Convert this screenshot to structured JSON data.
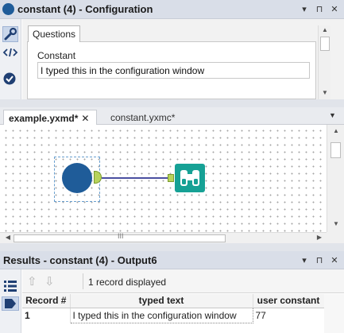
{
  "config": {
    "title": "constant (4) - Configuration",
    "tab_questions": "Questions",
    "constant_label": "Constant",
    "constant_value": "I typed this in the configuration window",
    "header_controls": [
      "▾",
      "⊓",
      "✕"
    ]
  },
  "document_tabs": [
    {
      "label": "example.yxmd*",
      "active": true,
      "close": "✕"
    },
    {
      "label": "constant.yxmc*",
      "active": false
    }
  ],
  "tabs_dropdown": "▼",
  "canvas": {
    "nodes": [
      {
        "name": "constant-tool",
        "color": "#1f5c99"
      },
      {
        "name": "browse-tool",
        "color": "#16a195"
      }
    ],
    "hscroll_grip": "III"
  },
  "results": {
    "title": "Results - constant (4) - Output6",
    "header_controls": [
      "▾",
      "⊓",
      "✕"
    ],
    "record_count": "1 record displayed",
    "columns": [
      "Record #",
      "typed text",
      "user constant"
    ],
    "rows": [
      [
        "1",
        "I typed this in the configuration window",
        "77"
      ]
    ]
  },
  "colors": {
    "header_bg": "#d9dee8",
    "constant_node": "#1f5c99",
    "browse_node": "#16a195",
    "anchor": "#b7d35b",
    "connection": "#4a4fa0"
  },
  "icons": [
    "wrench-icon",
    "code-icon",
    "check-circle-icon",
    "list-icon",
    "tag-icon",
    "binoculars-icon",
    "arrow-up-icon",
    "arrow-down-icon"
  ]
}
